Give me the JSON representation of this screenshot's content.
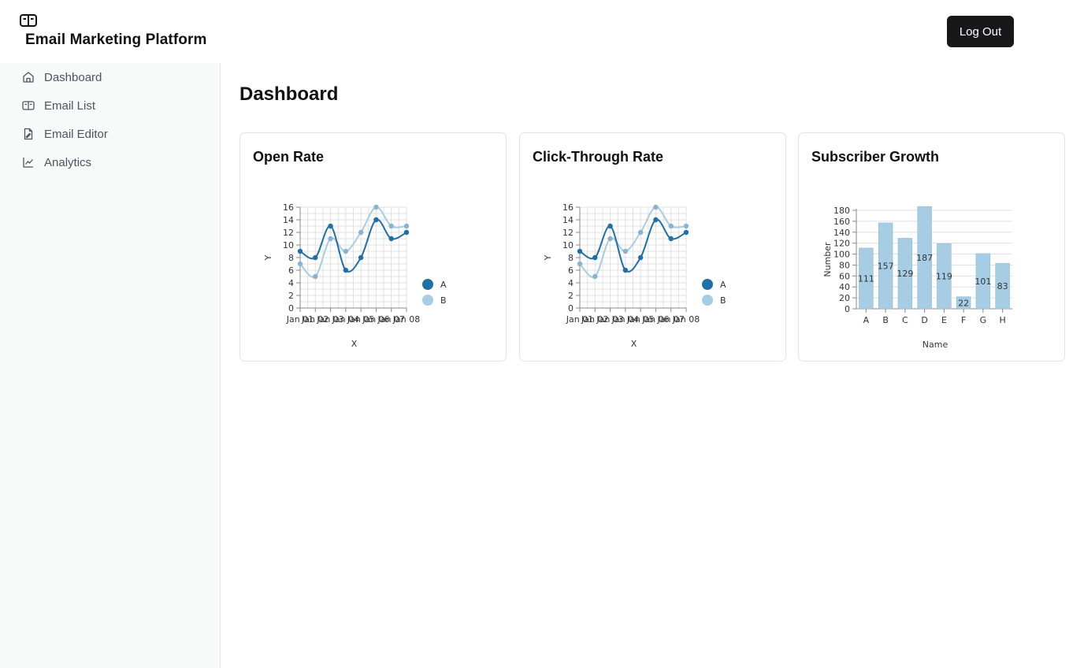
{
  "app": {
    "title": "Email Marketing Platform",
    "logout_label": "Log Out"
  },
  "sidebar": {
    "items": [
      {
        "label": "Dashboard",
        "icon": "home-icon"
      },
      {
        "label": "Email List",
        "icon": "mail-list-icon"
      },
      {
        "label": "Email Editor",
        "icon": "file-edit-icon"
      },
      {
        "label": "Analytics",
        "icon": "line-chart-icon"
      }
    ]
  },
  "main": {
    "title": "Dashboard"
  },
  "cards": [
    {
      "title": "Open Rate"
    },
    {
      "title": "Click-Through Rate"
    },
    {
      "title": "Subscriber Growth"
    }
  ],
  "colors": {
    "series_a": "#1f6fa8",
    "series_b": "#a6cde3",
    "bar": "#a6cde3",
    "sidebar_bg": "#f8f9f9",
    "button_bg": "#18181b"
  },
  "chart_data": [
    {
      "type": "line",
      "title": "Open Rate",
      "xlabel": "X",
      "ylabel": "Y",
      "x": [
        "Jan 01",
        "Jan 02",
        "Jan 03",
        "Jan 04",
        "Jan 05",
        "Jan 06",
        "Jan 07",
        "Jan 08"
      ],
      "ylim": [
        0,
        16
      ],
      "yticks": [
        0,
        2,
        4,
        6,
        8,
        10,
        12,
        14,
        16
      ],
      "grid": true,
      "legend": "right",
      "series": [
        {
          "name": "A",
          "values": [
            9,
            8,
            13,
            6,
            8,
            14,
            11,
            12
          ]
        },
        {
          "name": "B",
          "values": [
            7,
            5,
            11,
            9,
            12,
            16,
            13,
            13
          ]
        }
      ]
    },
    {
      "type": "line",
      "title": "Click-Through Rate",
      "xlabel": "X",
      "ylabel": "Y",
      "x": [
        "Jan 01",
        "Jan 02",
        "Jan 03",
        "Jan 04",
        "Jan 05",
        "Jan 06",
        "Jan 07",
        "Jan 08"
      ],
      "ylim": [
        0,
        16
      ],
      "yticks": [
        0,
        2,
        4,
        6,
        8,
        10,
        12,
        14,
        16
      ],
      "grid": true,
      "legend": "right",
      "series": [
        {
          "name": "A",
          "values": [
            9,
            8,
            13,
            6,
            8,
            14,
            11,
            12
          ]
        },
        {
          "name": "B",
          "values": [
            7,
            5,
            11,
            9,
            12,
            16,
            13,
            13
          ]
        }
      ]
    },
    {
      "type": "bar",
      "title": "Subscriber Growth",
      "xlabel": "Name",
      "ylabel": "Number",
      "categories": [
        "A",
        "B",
        "C",
        "D",
        "E",
        "F",
        "G",
        "H"
      ],
      "values": [
        111,
        157,
        129,
        187,
        119,
        22,
        101,
        83
      ],
      "ylim": [
        0,
        180
      ],
      "yticks": [
        0,
        20,
        40,
        60,
        80,
        100,
        120,
        140,
        160,
        180
      ],
      "grid": true
    }
  ]
}
